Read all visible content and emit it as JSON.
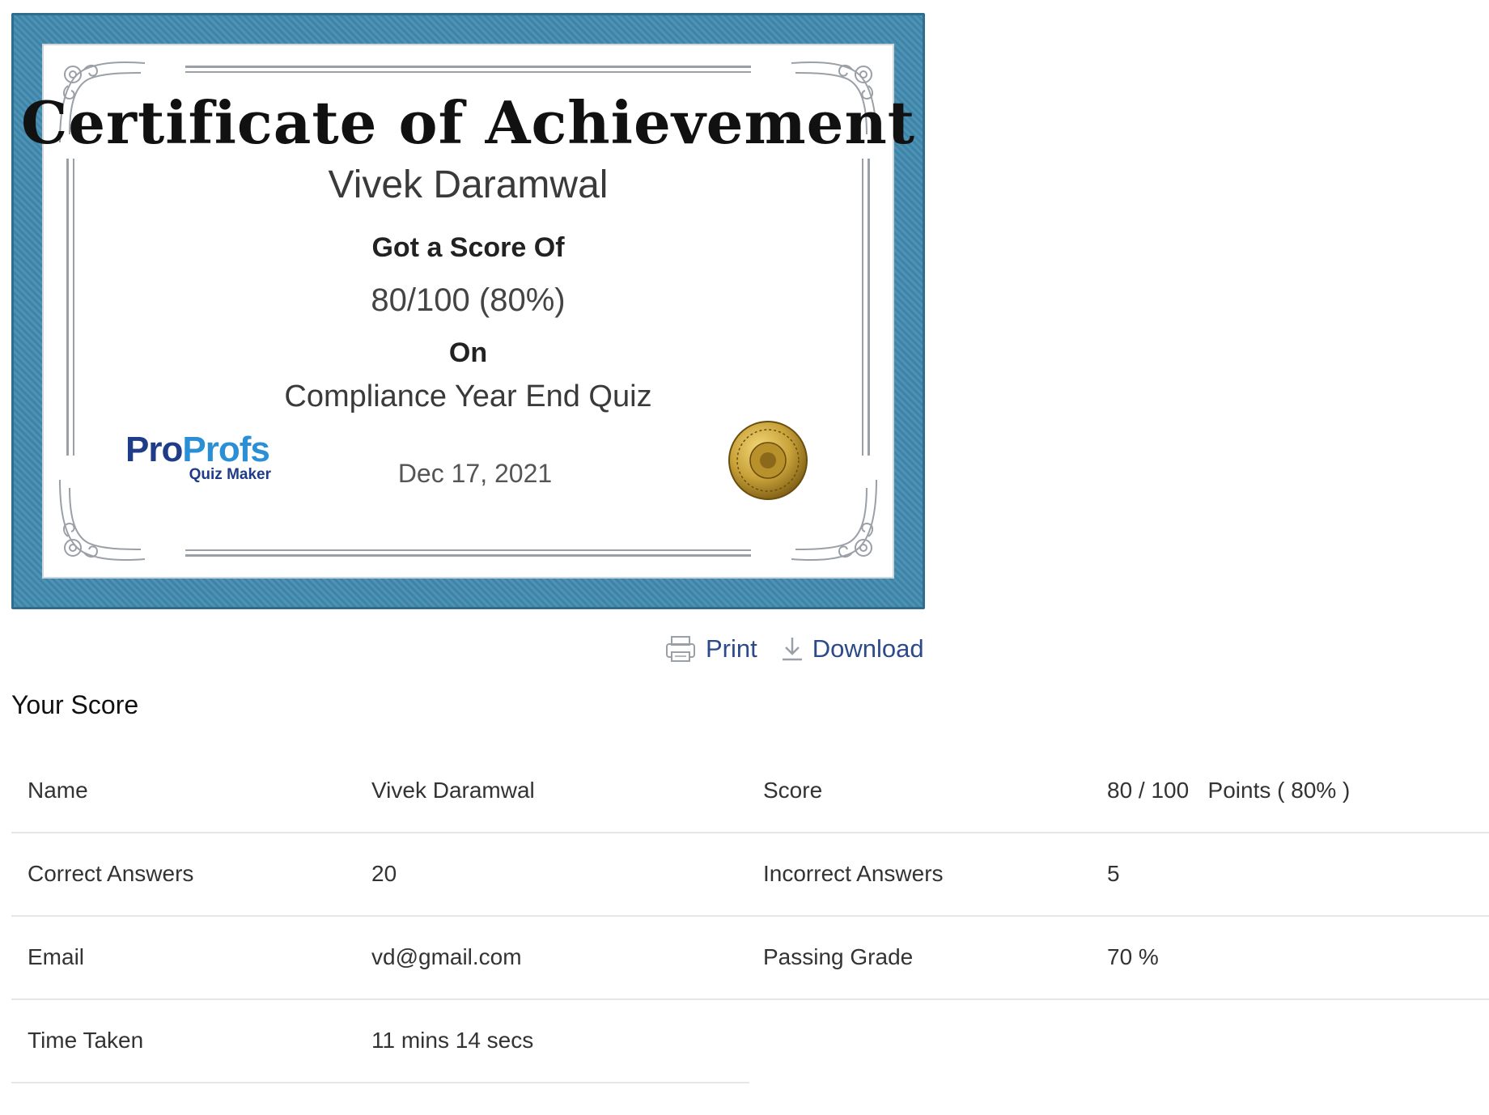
{
  "certificate": {
    "title": "Certificate of Achievement",
    "recipient": "Vivek Daramwal",
    "score_prefix": "Got a Score Of",
    "score": "80/100 (80%)",
    "on_label": "On",
    "quiz_name": "Compliance Year End Quiz",
    "date": "Dec 17, 2021",
    "logo": {
      "primary": "Pro",
      "secondary": "Profs",
      "subtitle": "Quiz Maker"
    },
    "frame_color": "#4a90b4"
  },
  "actions": {
    "print_label": "Print",
    "print_icon": "printer-icon",
    "download_label": "Download",
    "download_icon": "download-icon"
  },
  "score_section": {
    "title": "Your Score",
    "rows": [
      [
        {
          "label": "Name",
          "value": "Vivek Daramwal"
        },
        {
          "label": "Score",
          "value": "80 / 100   Points ( 80% )"
        }
      ],
      [
        {
          "label": "Correct Answers",
          "value": "20"
        },
        {
          "label": "Incorrect Answers",
          "value": "5"
        }
      ],
      [
        {
          "label": "Email",
          "value": "vd@gmail.com"
        },
        {
          "label": "Passing Grade",
          "value": "70 %"
        }
      ],
      [
        {
          "label": "Time Taken",
          "value": "11 mins 14 secs"
        }
      ]
    ]
  }
}
